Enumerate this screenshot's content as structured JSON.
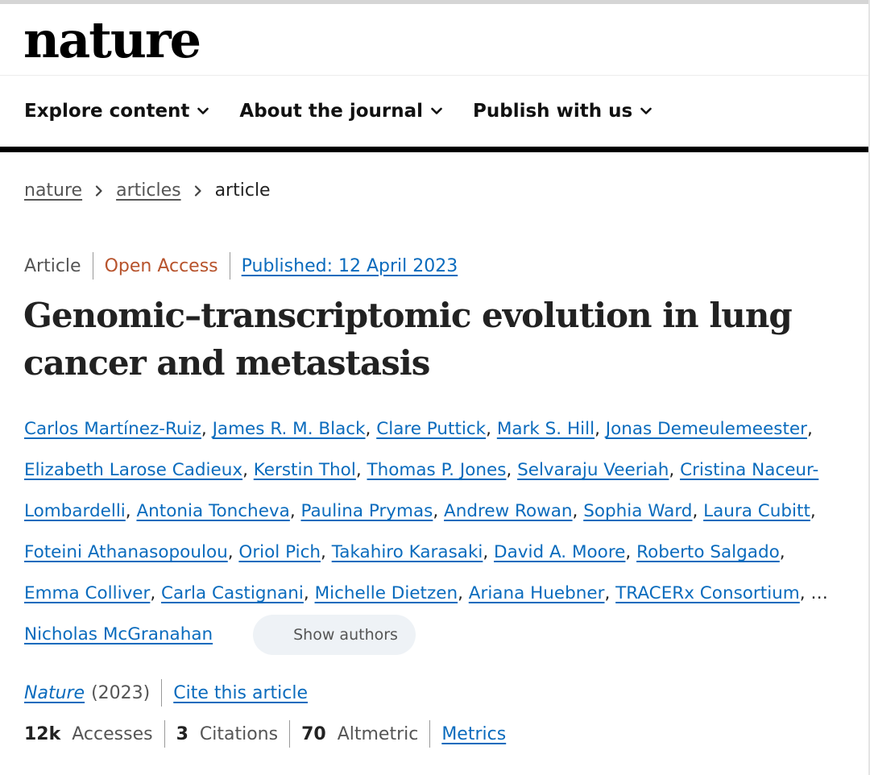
{
  "site": {
    "logo": "nature"
  },
  "nav": {
    "items": [
      {
        "label": "Explore content",
        "icon": "chevron-down-icon"
      },
      {
        "label": "About the journal",
        "icon": "chevron-down-icon"
      },
      {
        "label": "Publish with us",
        "icon": "chevron-down-icon"
      }
    ]
  },
  "breadcrumb": {
    "items": [
      {
        "label": "nature",
        "link": true
      },
      {
        "label": "articles",
        "link": true
      },
      {
        "label": "article",
        "link": false
      }
    ],
    "separator_icon": "chevron-right-icon"
  },
  "article": {
    "type": "Article",
    "access": "Open Access",
    "published": "Published: 12 April 2023",
    "title": "Genomic–transcriptomic evolution in lung cancer and metastasis",
    "authors": [
      "Carlos Martínez-Ruiz",
      "James R. M. Black",
      "Clare Puttick",
      "Mark S. Hill",
      "Jonas Demeulemeester",
      "Elizabeth Larose Cadieux",
      "Kerstin Thol",
      "Thomas P. Jones",
      "Selvaraju Veeriah",
      "Cristina Naceur-Lombardelli",
      "Antonia Toncheva",
      "Paulina Prymas",
      "Andrew Rowan",
      "Sophia Ward",
      "Laura Cubitt",
      "Foteini Athanasopoulou",
      "Oriol Pich",
      "Takahiro Karasaki",
      "David A. Moore",
      "Roberto Salgado",
      "Emma Colliver",
      "Carla Castignani",
      "Michelle Dietzen",
      "Ariana Huebner",
      "TRACERx Consortium"
    ],
    "authors_ellipsis": "…",
    "last_author": "Nicholas McGranahan",
    "show_authors_label": "Show authors",
    "journal": "Nature",
    "year": "(2023)",
    "cite_label": "Cite this article"
  },
  "metrics": {
    "accesses_value": "12k",
    "accesses_label": "Accesses",
    "citations_value": "3",
    "citations_label": "Citations",
    "altmetric_value": "70",
    "altmetric_label": "Altmetric",
    "metrics_link": "Metrics"
  },
  "colors": {
    "link": "#0a6bbd",
    "open_access": "#b7532c",
    "text": "#222222",
    "muted": "#555555",
    "rule": "#000000",
    "pill_bg": "#eef2f6"
  }
}
